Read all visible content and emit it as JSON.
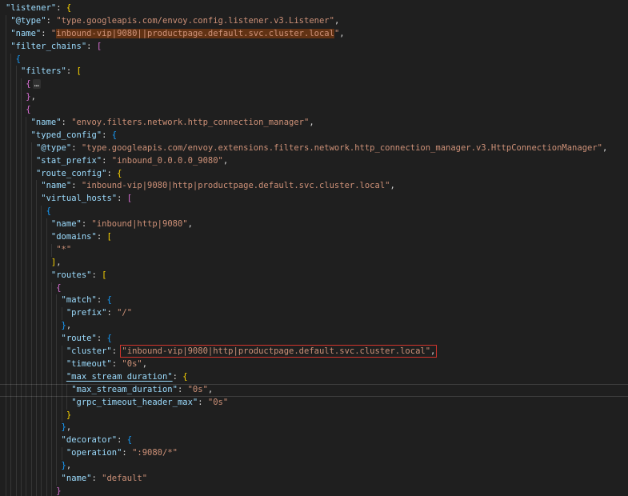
{
  "editor": {
    "background": "#1f1f1f",
    "language": "json",
    "colors": {
      "key": "#9cdcfe",
      "string": "#ce9178",
      "punctuation": "#d4d4d4",
      "bracket_gold": "#ffd700",
      "bracket_purple": "#da70d6",
      "bracket_blue": "#179fff",
      "find_match_background": "rgba(234,92,0,0.33)",
      "annotation_red": "#d0342c",
      "indent_guide": "rgba(255,255,255,0.10)",
      "cursor_line_border": "rgba(255,255,255,0.14)"
    },
    "lines": [
      {
        "indent": 0,
        "tokens": [
          [
            "key",
            "\"listener\""
          ],
          [
            "punc",
            ": "
          ],
          [
            "b0",
            "{"
          ]
        ]
      },
      {
        "indent": 1,
        "tokens": [
          [
            "key",
            "\"@type\""
          ],
          [
            "punc",
            ": "
          ],
          [
            "str",
            "\"type.googleapis.com/envoy.config.listener.v3.Listener\""
          ],
          [
            "punc",
            ","
          ]
        ]
      },
      {
        "indent": 1,
        "tokens": [
          [
            "key",
            "\"name\""
          ],
          [
            "punc",
            ": "
          ],
          [
            "str",
            "\""
          ],
          [
            "str hl",
            "inbound-vip|9080||productpage.default.svc.cluster.local"
          ],
          [
            "str",
            "\""
          ],
          [
            "punc",
            ","
          ]
        ]
      },
      {
        "indent": 1,
        "tokens": [
          [
            "key",
            "\"filter_chains\""
          ],
          [
            "punc",
            ": "
          ],
          [
            "b1",
            "["
          ]
        ]
      },
      {
        "indent": 2,
        "tokens": [
          [
            "b2",
            "{"
          ]
        ]
      },
      {
        "indent": 3,
        "tokens": [
          [
            "key",
            "\"filters\""
          ],
          [
            "punc",
            ": "
          ],
          [
            "b0",
            "["
          ]
        ]
      },
      {
        "indent": 4,
        "tokens": [
          [
            "b1",
            "{"
          ],
          [
            "fold",
            "…"
          ]
        ]
      },
      {
        "indent": 4,
        "tokens": [
          [
            "b1",
            "}"
          ],
          [
            "punc",
            ","
          ]
        ]
      },
      {
        "indent": 4,
        "tokens": [
          [
            "b1",
            "{"
          ]
        ]
      },
      {
        "indent": 5,
        "tokens": [
          [
            "key",
            "\"name\""
          ],
          [
            "punc",
            ": "
          ],
          [
            "str",
            "\"envoy.filters.network.http_connection_manager\""
          ],
          [
            "punc",
            ","
          ]
        ]
      },
      {
        "indent": 5,
        "tokens": [
          [
            "key",
            "\"typed_config\""
          ],
          [
            "punc",
            ": "
          ],
          [
            "b2",
            "{"
          ]
        ]
      },
      {
        "indent": 6,
        "tokens": [
          [
            "key",
            "\"@type\""
          ],
          [
            "punc",
            ": "
          ],
          [
            "str",
            "\"type.googleapis.com/envoy.extensions.filters.network.http_connection_manager.v3.HttpConnectionManager\""
          ],
          [
            "punc",
            ","
          ]
        ]
      },
      {
        "indent": 6,
        "tokens": [
          [
            "key",
            "\"stat_prefix\""
          ],
          [
            "punc",
            ": "
          ],
          [
            "str",
            "\"inbound_0.0.0.0_9080\""
          ],
          [
            "punc",
            ","
          ]
        ]
      },
      {
        "indent": 6,
        "tokens": [
          [
            "key",
            "\"route_config\""
          ],
          [
            "punc",
            ": "
          ],
          [
            "b0",
            "{"
          ]
        ]
      },
      {
        "indent": 7,
        "tokens": [
          [
            "key",
            "\"name\""
          ],
          [
            "punc",
            ": "
          ],
          [
            "str",
            "\"inbound-vip|9080|http|productpage.default.svc.cluster.local\""
          ],
          [
            "punc",
            ","
          ]
        ]
      },
      {
        "indent": 7,
        "tokens": [
          [
            "key",
            "\"virtual_hosts\""
          ],
          [
            "punc",
            ": "
          ],
          [
            "b1",
            "["
          ]
        ]
      },
      {
        "indent": 8,
        "tokens": [
          [
            "b2",
            "{"
          ]
        ]
      },
      {
        "indent": 9,
        "tokens": [
          [
            "key",
            "\"name\""
          ],
          [
            "punc",
            ": "
          ],
          [
            "str",
            "\"inbound|http|9080\""
          ],
          [
            "punc",
            ","
          ]
        ]
      },
      {
        "indent": 9,
        "tokens": [
          [
            "key",
            "\"domains\""
          ],
          [
            "punc",
            ": "
          ],
          [
            "b0",
            "["
          ]
        ]
      },
      {
        "indent": 10,
        "tokens": [
          [
            "str",
            "\"*\""
          ]
        ]
      },
      {
        "indent": 9,
        "tokens": [
          [
            "b0",
            "]"
          ],
          [
            "punc",
            ","
          ]
        ]
      },
      {
        "indent": 9,
        "tokens": [
          [
            "key",
            "\"routes\""
          ],
          [
            "punc",
            ": "
          ],
          [
            "b0",
            "["
          ]
        ]
      },
      {
        "indent": 10,
        "tokens": [
          [
            "b1",
            "{"
          ]
        ]
      },
      {
        "indent": 11,
        "tokens": [
          [
            "key",
            "\"match\""
          ],
          [
            "punc",
            ": "
          ],
          [
            "b2",
            "{"
          ]
        ]
      },
      {
        "indent": 12,
        "tokens": [
          [
            "key",
            "\"prefix\""
          ],
          [
            "punc",
            ": "
          ],
          [
            "str",
            "\"/\""
          ]
        ]
      },
      {
        "indent": 11,
        "tokens": [
          [
            "b2",
            "}"
          ],
          [
            "punc",
            ","
          ]
        ]
      },
      {
        "indent": 11,
        "tokens": [
          [
            "key",
            "\"route\""
          ],
          [
            "punc",
            ": "
          ],
          [
            "b2",
            "{"
          ]
        ]
      },
      {
        "indent": 12,
        "tokens": [
          [
            "key",
            "\"cluster\""
          ],
          [
            "punc",
            ": "
          ],
          {
            "group": "redbox",
            "name": "annotation-red-box",
            "tokens": [
              [
                "str",
                "\"inbound-vip|9080|http|productpage.default.svc.cluster.local\""
              ],
              [
                "punc",
                ","
              ]
            ]
          }
        ]
      },
      {
        "indent": 12,
        "tokens": [
          [
            "key",
            "\"timeout\""
          ],
          [
            "punc",
            ": "
          ],
          [
            "str",
            "\"0s\""
          ],
          [
            "punc",
            ","
          ]
        ]
      },
      {
        "indent": 12,
        "tokens": [
          [
            "key u",
            "\"max_stream_duration\""
          ],
          [
            "punc",
            ": "
          ],
          [
            "b0",
            "{"
          ]
        ]
      },
      {
        "indent": 13,
        "cursor": true,
        "tokens": [
          [
            "key",
            "\"max_stream_duration\""
          ],
          [
            "punc",
            ": "
          ],
          [
            "str",
            "\"0s\""
          ],
          [
            "punc",
            ","
          ]
        ]
      },
      {
        "indent": 13,
        "tokens": [
          [
            "key",
            "\"grpc_timeout_header_max\""
          ],
          [
            "punc",
            ": "
          ],
          [
            "str",
            "\"0s\""
          ]
        ]
      },
      {
        "indent": 12,
        "tokens": [
          [
            "b0",
            "}"
          ]
        ]
      },
      {
        "indent": 11,
        "tokens": [
          [
            "b2",
            "}"
          ],
          [
            "punc",
            ","
          ]
        ]
      },
      {
        "indent": 11,
        "tokens": [
          [
            "key",
            "\"decorator\""
          ],
          [
            "punc",
            ": "
          ],
          [
            "b2",
            "{"
          ]
        ]
      },
      {
        "indent": 12,
        "tokens": [
          [
            "key",
            "\"operation\""
          ],
          [
            "punc",
            ": "
          ],
          [
            "str",
            "\":9080/*\""
          ]
        ]
      },
      {
        "indent": 11,
        "tokens": [
          [
            "b2",
            "}"
          ],
          [
            "punc",
            ","
          ]
        ]
      },
      {
        "indent": 11,
        "tokens": [
          [
            "key",
            "\"name\""
          ],
          [
            "punc",
            ": "
          ],
          [
            "str",
            "\"default\""
          ]
        ]
      },
      {
        "indent": 10,
        "tokens": [
          [
            "b1",
            "}"
          ]
        ]
      }
    ]
  }
}
